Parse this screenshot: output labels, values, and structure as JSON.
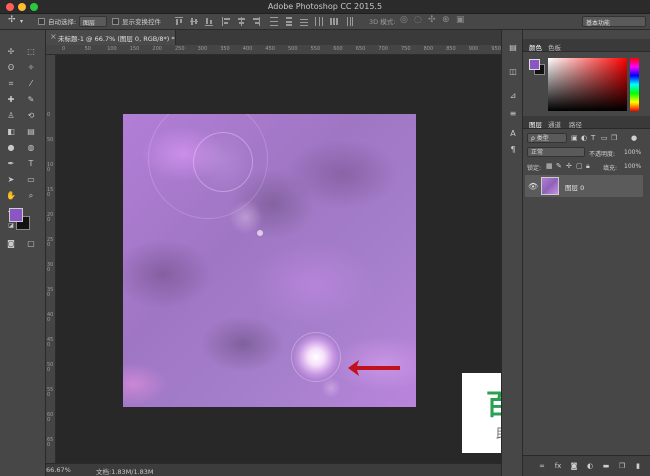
{
  "window": {
    "title": "Adobe Photoshop CC 2015.5"
  },
  "options_bar": {
    "auto_select_label": "自动选择:",
    "auto_select_value": "图层",
    "show_transform_label": "显示变换控件",
    "mode3d_label": "3D 模式:",
    "workspace_value": "基本功能"
  },
  "document": {
    "tab_label": "未标题-1 @ 66.7% (图层 0, RGB/8*) *",
    "zoom": "66.67%",
    "doc_info": "文档:1.83M/1.83M"
  },
  "ruler": {
    "h_ticks": [
      "0",
      "50",
      "100",
      "150",
      "200",
      "250",
      "300",
      "350",
      "400",
      "450",
      "500",
      "550",
      "600",
      "650",
      "700",
      "750",
      "800",
      "850",
      "900",
      "950"
    ],
    "v_ticks": [
      "0",
      "50",
      "100",
      "150",
      "200",
      "250",
      "300",
      "350",
      "400",
      "450",
      "500",
      "550",
      "600",
      "650"
    ]
  },
  "color_panel": {
    "tabs": [
      "颜色",
      "色板"
    ],
    "foreground": "#8b56c4",
    "background": "#111111"
  },
  "layers_panel": {
    "tabs": [
      "图层",
      "通道",
      "路径"
    ],
    "filter_label": "ρ 类型",
    "blend_mode": "正常",
    "opacity_label": "不透明度:",
    "opacity_value": "100%",
    "lock_label": "锁定:",
    "fill_label": "填充:",
    "fill_value": "100%",
    "layer_name": "图层 0"
  },
  "watermark": {
    "title": "百科全说",
    "subtitle": "助你轻松解决"
  },
  "colors": {
    "accent_arrow": "#c0111c",
    "watermark_green": "#2aa052"
  }
}
